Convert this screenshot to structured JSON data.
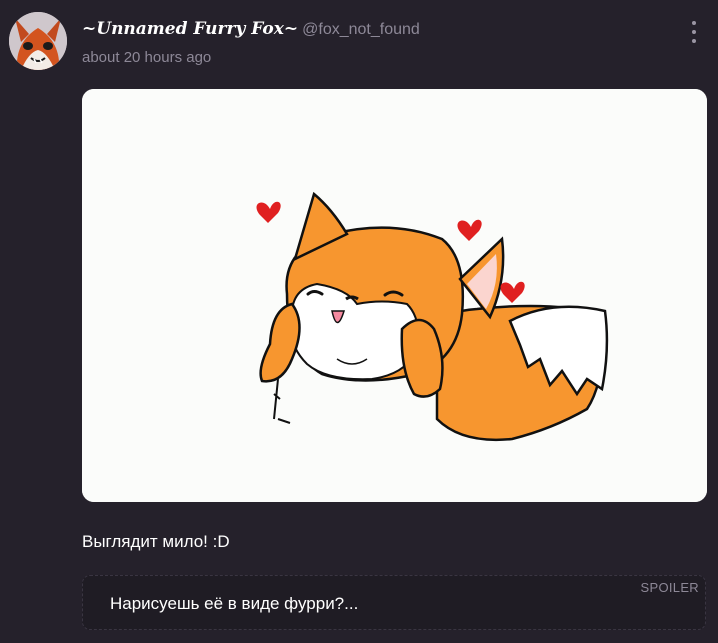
{
  "post": {
    "author_name": "~Unnamed Furry Fox~",
    "author_handle": "@fox_not_found",
    "timestamp": "about 20 hours ago",
    "caption": "Выглядит мило! :D",
    "spoiler": {
      "label": "SPOILER",
      "text": "Нарисуешь её в виде фурри?..."
    }
  },
  "icons": {
    "more": "vertical-ellipsis-icon"
  },
  "colors": {
    "background": "#25212b",
    "muted_text": "#8d8897",
    "fox_orange": "#f7962f",
    "heart_red": "#e02020"
  }
}
